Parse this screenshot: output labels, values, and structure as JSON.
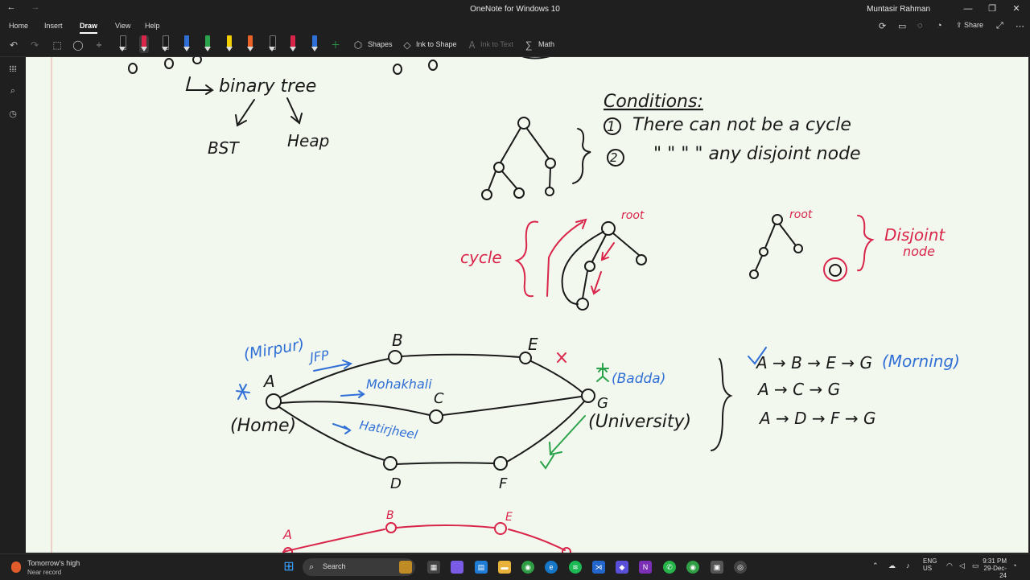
{
  "window": {
    "title": "OneNote for Windows 10",
    "user": "Muntasir Rahman",
    "back_icon": "back-arrow-icon",
    "forward_icon": "forward-arrow-icon",
    "controls": [
      "minimize-icon",
      "restore-icon",
      "close-icon"
    ]
  },
  "menu": {
    "tabs": [
      "Home",
      "Insert",
      "Draw",
      "View",
      "Help"
    ],
    "active": "Draw",
    "right": {
      "share_label": "Share"
    }
  },
  "ribbon": {
    "shapes_label": "Shapes",
    "ink_to_shape_label": "Ink to Shape",
    "ink_to_text_label": "Ink to Text",
    "math_label": "Math",
    "pen_colors": [
      "#1a1a1a",
      "#d9254a",
      "#1a1a1a",
      "#2f6fd6",
      "#2aa34a",
      "#f2d000",
      "#e8622a",
      "#1a1a1a",
      "#d9254a",
      "#2f6fd6"
    ]
  },
  "notes": {
    "binary_tree": "binary tree",
    "bst": "BST",
    "heap": "Heap",
    "conditions_title": "Conditions:",
    "condition_1": "There can not be a cycle",
    "condition_2": "\"  \"  \"  \"  any disjoint node",
    "condition_1_num": "1",
    "condition_2_num": "2",
    "cycle": "cycle",
    "root_1": "root",
    "root_2": "root",
    "disjoint": "Disjoint",
    "disjoint_node": "node",
    "mirpur": "(Mirpur)",
    "jfp": "JFP",
    "home": "(Home)",
    "mohakhali": "Mohakhali",
    "hatirjheel": "Hatirjheel",
    "badda": "(Badda)",
    "university": "(University)",
    "node_a": "A",
    "node_b": "B",
    "node_c": "C",
    "node_d": "D",
    "node_e": "E",
    "node_f": "F",
    "node_g": "G",
    "path_1": "A → B → E → G",
    "path_1_note": "(Morning)",
    "path_2": "A → C → G",
    "path_3": "A → D → F → G",
    "red_a": "A",
    "red_b": "B",
    "red_e": "E"
  },
  "taskbar": {
    "weather_title": "Tomorrow's high",
    "weather_sub": "Near record",
    "search_placeholder": "Search",
    "lang_1": "ENG",
    "lang_2": "US",
    "time": "9:31 PM",
    "date": "29-Dec-24"
  }
}
